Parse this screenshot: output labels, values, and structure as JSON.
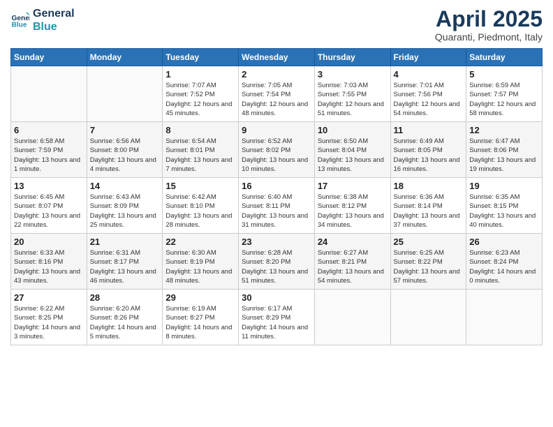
{
  "logo": {
    "line1": "General",
    "line2": "Blue"
  },
  "title": "April 2025",
  "location": "Quaranti, Piedmont, Italy",
  "days_header": [
    "Sunday",
    "Monday",
    "Tuesday",
    "Wednesday",
    "Thursday",
    "Friday",
    "Saturday"
  ],
  "weeks": [
    [
      {
        "num": "",
        "detail": ""
      },
      {
        "num": "",
        "detail": ""
      },
      {
        "num": "1",
        "detail": "Sunrise: 7:07 AM\nSunset: 7:52 PM\nDaylight: 12 hours and 45 minutes."
      },
      {
        "num": "2",
        "detail": "Sunrise: 7:05 AM\nSunset: 7:54 PM\nDaylight: 12 hours and 48 minutes."
      },
      {
        "num": "3",
        "detail": "Sunrise: 7:03 AM\nSunset: 7:55 PM\nDaylight: 12 hours and 51 minutes."
      },
      {
        "num": "4",
        "detail": "Sunrise: 7:01 AM\nSunset: 7:56 PM\nDaylight: 12 hours and 54 minutes."
      },
      {
        "num": "5",
        "detail": "Sunrise: 6:59 AM\nSunset: 7:57 PM\nDaylight: 12 hours and 58 minutes."
      }
    ],
    [
      {
        "num": "6",
        "detail": "Sunrise: 6:58 AM\nSunset: 7:59 PM\nDaylight: 13 hours and 1 minute."
      },
      {
        "num": "7",
        "detail": "Sunrise: 6:56 AM\nSunset: 8:00 PM\nDaylight: 13 hours and 4 minutes."
      },
      {
        "num": "8",
        "detail": "Sunrise: 6:54 AM\nSunset: 8:01 PM\nDaylight: 13 hours and 7 minutes."
      },
      {
        "num": "9",
        "detail": "Sunrise: 6:52 AM\nSunset: 8:02 PM\nDaylight: 13 hours and 10 minutes."
      },
      {
        "num": "10",
        "detail": "Sunrise: 6:50 AM\nSunset: 8:04 PM\nDaylight: 13 hours and 13 minutes."
      },
      {
        "num": "11",
        "detail": "Sunrise: 6:49 AM\nSunset: 8:05 PM\nDaylight: 13 hours and 16 minutes."
      },
      {
        "num": "12",
        "detail": "Sunrise: 6:47 AM\nSunset: 8:06 PM\nDaylight: 13 hours and 19 minutes."
      }
    ],
    [
      {
        "num": "13",
        "detail": "Sunrise: 6:45 AM\nSunset: 8:07 PM\nDaylight: 13 hours and 22 minutes."
      },
      {
        "num": "14",
        "detail": "Sunrise: 6:43 AM\nSunset: 8:09 PM\nDaylight: 13 hours and 25 minutes."
      },
      {
        "num": "15",
        "detail": "Sunrise: 6:42 AM\nSunset: 8:10 PM\nDaylight: 13 hours and 28 minutes."
      },
      {
        "num": "16",
        "detail": "Sunrise: 6:40 AM\nSunset: 8:11 PM\nDaylight: 13 hours and 31 minutes."
      },
      {
        "num": "17",
        "detail": "Sunrise: 6:38 AM\nSunset: 8:12 PM\nDaylight: 13 hours and 34 minutes."
      },
      {
        "num": "18",
        "detail": "Sunrise: 6:36 AM\nSunset: 8:14 PM\nDaylight: 13 hours and 37 minutes."
      },
      {
        "num": "19",
        "detail": "Sunrise: 6:35 AM\nSunset: 8:15 PM\nDaylight: 13 hours and 40 minutes."
      }
    ],
    [
      {
        "num": "20",
        "detail": "Sunrise: 6:33 AM\nSunset: 8:16 PM\nDaylight: 13 hours and 43 minutes."
      },
      {
        "num": "21",
        "detail": "Sunrise: 6:31 AM\nSunset: 8:17 PM\nDaylight: 13 hours and 46 minutes."
      },
      {
        "num": "22",
        "detail": "Sunrise: 6:30 AM\nSunset: 8:19 PM\nDaylight: 13 hours and 48 minutes."
      },
      {
        "num": "23",
        "detail": "Sunrise: 6:28 AM\nSunset: 8:20 PM\nDaylight: 13 hours and 51 minutes."
      },
      {
        "num": "24",
        "detail": "Sunrise: 6:27 AM\nSunset: 8:21 PM\nDaylight: 13 hours and 54 minutes."
      },
      {
        "num": "25",
        "detail": "Sunrise: 6:25 AM\nSunset: 8:22 PM\nDaylight: 13 hours and 57 minutes."
      },
      {
        "num": "26",
        "detail": "Sunrise: 6:23 AM\nSunset: 8:24 PM\nDaylight: 14 hours and 0 minutes."
      }
    ],
    [
      {
        "num": "27",
        "detail": "Sunrise: 6:22 AM\nSunset: 8:25 PM\nDaylight: 14 hours and 3 minutes."
      },
      {
        "num": "28",
        "detail": "Sunrise: 6:20 AM\nSunset: 8:26 PM\nDaylight: 14 hours and 5 minutes."
      },
      {
        "num": "29",
        "detail": "Sunrise: 6:19 AM\nSunset: 8:27 PM\nDaylight: 14 hours and 8 minutes."
      },
      {
        "num": "30",
        "detail": "Sunrise: 6:17 AM\nSunset: 8:29 PM\nDaylight: 14 hours and 11 minutes."
      },
      {
        "num": "",
        "detail": ""
      },
      {
        "num": "",
        "detail": ""
      },
      {
        "num": "",
        "detail": ""
      }
    ]
  ]
}
